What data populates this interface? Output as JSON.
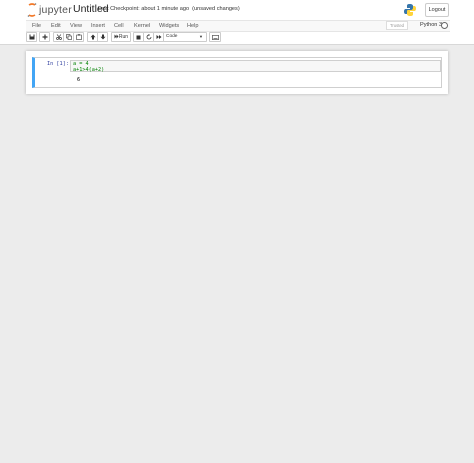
{
  "header": {
    "logo_text": "jupyter",
    "notebook_title": "Untitled",
    "checkpoint_text": "Last Checkpoint: about 1 minute ago",
    "unsaved_text": "(unsaved changes)",
    "logout_label": "Logout",
    "logo_icon": "jupyter-logo-icon",
    "python_icon": "python-logo-icon"
  },
  "menubar": {
    "items": [
      "File",
      "Edit",
      "View",
      "Insert",
      "Cell",
      "Kernel",
      "Widgets",
      "Help"
    ],
    "trusted_label": "Trusted",
    "kernel_name": "Python 3",
    "kernel_status_icon": "kernel-idle-icon"
  },
  "toolbar": {
    "run_label": "Run",
    "cell_type": "Code",
    "buttons": [
      "save-icon",
      "add-cell-icon",
      "cut-icon",
      "copy-icon",
      "paste-icon",
      "move-up-icon",
      "move-down-icon",
      "run-icon",
      "stop-icon",
      "restart-icon",
      "fast-forward-icon",
      "keyboard-icon"
    ]
  },
  "cell": {
    "prompt": "In [1]:",
    "code_lines": [
      "a = 4",
      "a+1>4(a+2)"
    ],
    "output": "6"
  },
  "colors": {
    "accent": "#42a5f5",
    "prompt": "#303f9f",
    "background": "#ececec"
  }
}
